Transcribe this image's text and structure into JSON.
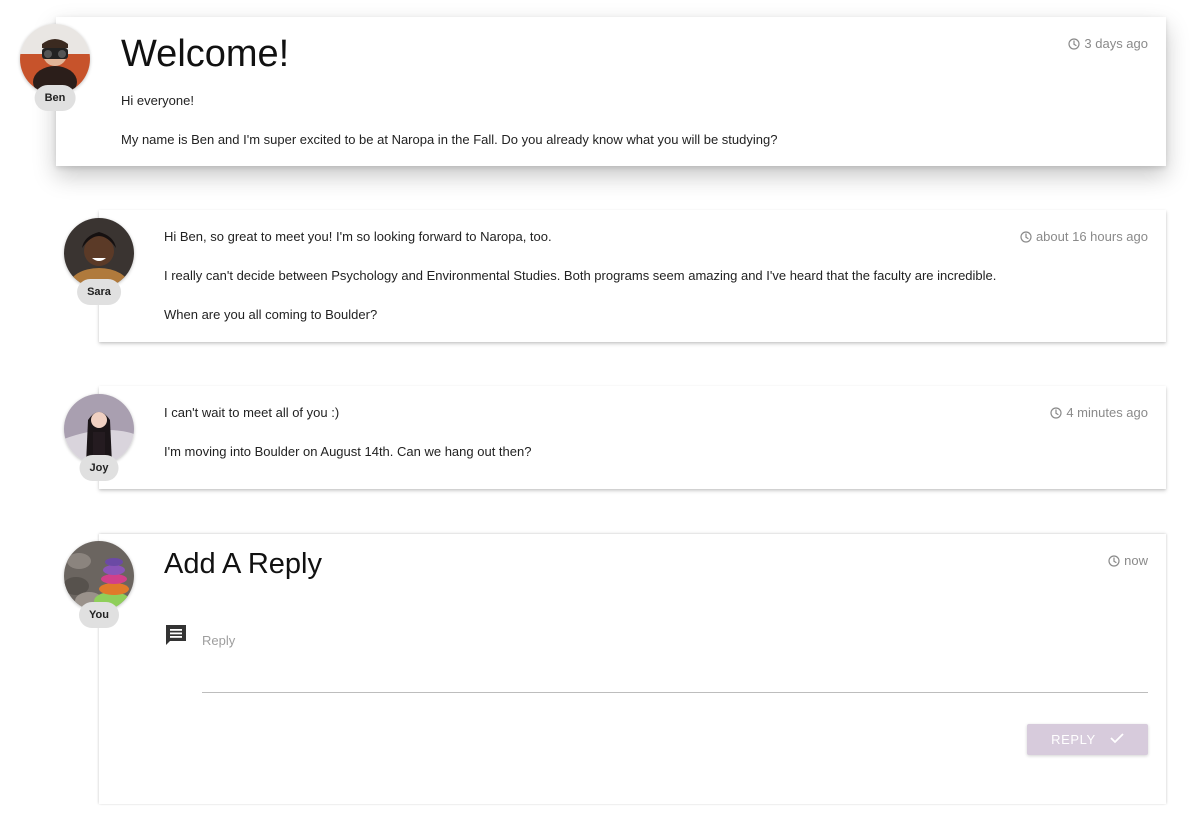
{
  "posts": {
    "main": {
      "author": "Ben",
      "time": "3 days ago",
      "title": "Welcome!",
      "lines": [
        "Hi everyone!",
        "My name is Ben and I'm super excited to be at Naropa in the Fall. Do you already know what you will be studying?"
      ]
    },
    "sara": {
      "author": "Sara",
      "time": "about 16 hours ago",
      "lines": [
        "Hi Ben, so great to meet you! I'm so looking forward to Naropa, too.",
        "I really can't decide between Psychology and Environmental Studies. Both programs seem amazing and I've heard that the faculty are incredible.",
        "When are you all coming to Boulder?"
      ]
    },
    "joy": {
      "author": "Joy",
      "time": "4 minutes ago",
      "lines": [
        "I can't wait to meet all of you :)",
        "I'm moving into Boulder on August 14th. Can we hang out then?"
      ]
    }
  },
  "reply_form": {
    "author": "You",
    "time": "now",
    "title": "Add A Reply",
    "placeholder": "Reply",
    "button_label": "REPLY"
  },
  "icons": {
    "timestamp": "clock-icon",
    "reply_field": "chat-bubble-icon",
    "submit": "checkmark-icon"
  },
  "colors": {
    "button_bg": "#d7cbdc",
    "badge_bg": "#e0e0e0",
    "muted_text": "#8a8a8a"
  }
}
